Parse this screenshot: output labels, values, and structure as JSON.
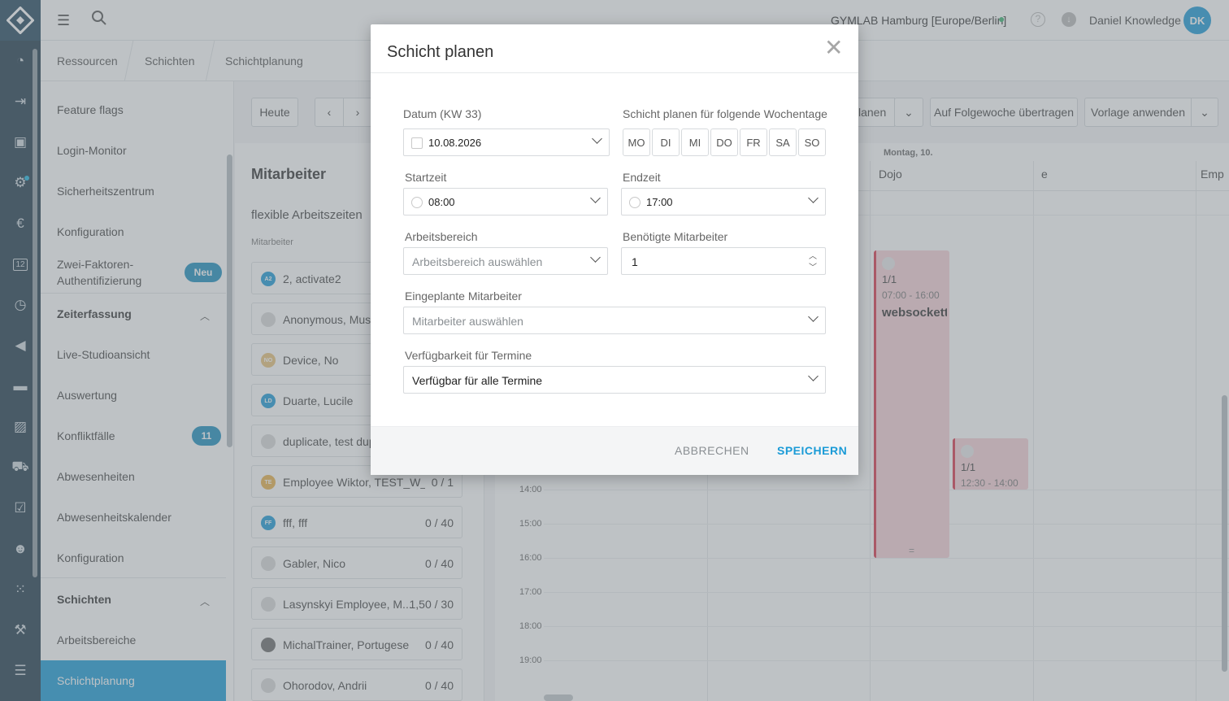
{
  "app": {
    "logo": "gymlab-diamond-logo",
    "rail_icons": [
      "dashboard-icon",
      "checkin-icon",
      "contacts-icon",
      "settings-alert-icon",
      "euro-icon",
      "calendar-icon",
      "timer-icon",
      "megaphone-icon",
      "chat-icon",
      "chart-icon",
      "cart-icon",
      "tasks-icon",
      "group-icon",
      "grid-dots-icon",
      "dumbbell-icon",
      "sliders-icon"
    ],
    "rail_calendar_day": "12"
  },
  "topbar": {
    "studio": "GYMLAB Hamburg [Europe/Berlin]",
    "user_name": "Daniel Knowledge",
    "user_initials": "DK",
    "help_glyph": "?"
  },
  "breadcrumb": [
    "Ressourcen",
    "Schichten",
    "Schichtplanung"
  ],
  "sidebar": {
    "items_top": [
      "Feature flags",
      "Login-Monitor",
      "Sicherheitszentrum",
      "Konfiguration"
    ],
    "two_factor": {
      "line1": "Zwei-Faktoren-",
      "line2": "Authentifizierung",
      "badge": "Neu"
    },
    "zeiterfassung": {
      "label": "Zeiterfassung",
      "items": [
        "Live-Studioansicht",
        "Auswertung",
        "Konfliktfälle",
        "Abwesenheiten",
        "Abwesenheitskalender",
        "Konfiguration"
      ],
      "konflikt_badge": "11"
    },
    "schichten": {
      "label": "Schichten",
      "items": [
        "Arbeitsbereiche",
        "Schichtplanung"
      ]
    }
  },
  "toolbar": {
    "today": "Heute",
    "plan_partial": "lanen",
    "copy_week": "Auf Folgewoche übertragen",
    "apply_template": "Vorlage anwenden"
  },
  "employees_panel": {
    "title": "Mitarbeiter",
    "subtitle": "flexible Arbeitszeiten",
    "column_label": "Mitarbeiter",
    "rows": [
      {
        "initials": "A2",
        "color": "#1c9ad6",
        "name": "2, activate2",
        "count": ""
      },
      {
        "initials": "",
        "color": "#d8d8d8",
        "name": "Anonymous, Muste",
        "count": ""
      },
      {
        "initials": "NO",
        "color": "#e8c17a",
        "name": "Device, No",
        "count": ""
      },
      {
        "initials": "LD",
        "color": "#1c9ad6",
        "name": "Duarte, Lucile",
        "count": ""
      },
      {
        "initials": "",
        "color": "#d8d8d8",
        "name": "duplicate, test dup",
        "count": ""
      },
      {
        "initials": "TE",
        "color": "#e8b04a",
        "name": "Employee Wiktor, TEST_W_...",
        "count": "0 / 1"
      },
      {
        "initials": "FF",
        "color": "#1c9ad6",
        "name": "fff, fff",
        "count": "0 / 40"
      },
      {
        "initials": "",
        "color": "#d8d8d8",
        "name": "Gabler, Nico",
        "count": "0 / 40"
      },
      {
        "initials": "",
        "color": "#d8d8d8",
        "name": "Lasynskyi Employee, M...",
        "count": "1,50 / 30"
      },
      {
        "initials": "",
        "color": "#6b6b6b",
        "name": "MichalTrainer, Portugese",
        "count": "0 / 40"
      },
      {
        "initials": "",
        "color": "#d8d8d8",
        "name": "Ohorodov, Andrii",
        "count": "0 / 40"
      }
    ]
  },
  "calendar": {
    "day_label": "Montag, 10.",
    "columns": [
      "Dojo",
      "e",
      "Emp"
    ],
    "times": [
      "14:00",
      "15:00",
      "16:00",
      "17:00",
      "18:00",
      "19:00"
    ],
    "shifts": [
      {
        "fraction": "1/1",
        "time": "07:00 - 16:00",
        "name": "websockett"
      },
      {
        "fraction": "1/1",
        "time": "12:30 - 14:00",
        "name": ""
      }
    ],
    "drag_handle": "="
  },
  "modal": {
    "title": "Schicht planen",
    "close_glyph": "✕",
    "date_label": "Datum (KW 33)",
    "date_value": "10.08.2026",
    "weekdays_label": "Schicht planen für folgende Wochentage",
    "weekdays": [
      "MO",
      "DI",
      "MI",
      "DO",
      "FR",
      "SA",
      "SO"
    ],
    "start_label": "Startzeit",
    "start_value": "08:00",
    "end_label": "Endzeit",
    "end_value": "17:00",
    "area_label": "Arbeitsbereich",
    "area_placeholder": "Arbeitsbereich auswählen",
    "needed_label": "Benötigte Mitarbeiter",
    "needed_value": "1",
    "planned_label": "Eingeplante Mitarbeiter",
    "planned_placeholder": "Mitarbeiter auswählen",
    "availability_label": "Verfügbarkeit für Termine",
    "availability_value": "Verfügbar für alle Termine",
    "cancel": "ABBRECHEN",
    "save": "SPEICHERN"
  }
}
